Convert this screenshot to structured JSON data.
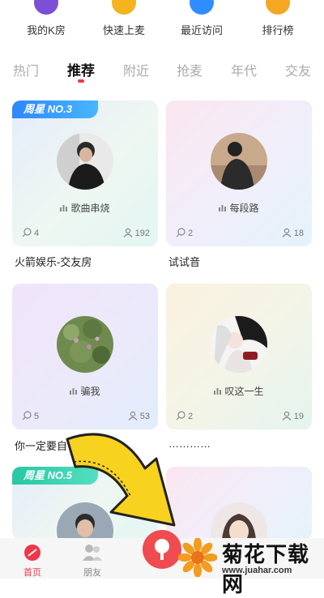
{
  "quick_entries": [
    {
      "label": "我的K房",
      "icon": "k-room-icon",
      "color": "#7b4fd6"
    },
    {
      "label": "快速上麦",
      "icon": "quick-mic-icon",
      "color": "#f5b31e"
    },
    {
      "label": "最近访问",
      "icon": "recent-visit-icon",
      "color": "#2f8dff"
    },
    {
      "label": "排行榜",
      "icon": "ranking-icon",
      "color": "#f5a623"
    }
  ],
  "tabs": [
    "热门",
    "推荐",
    "附近",
    "抢麦",
    "年代",
    "交友"
  ],
  "active_tab": "推荐",
  "rooms": [
    {
      "badge": "周星 NO.3",
      "song": "歌曲串烧",
      "comments": "4",
      "members": "192",
      "title": "火箭娱乐-交友房"
    },
    {
      "badge": "",
      "song": "每段路",
      "comments": "2",
      "members": "18",
      "title": "试试音"
    },
    {
      "badge": "",
      "song": "骗我",
      "comments": "5",
      "members": "53",
      "title": "你一定要自"
    },
    {
      "badge": "",
      "song": "叹这一生",
      "comments": "2",
      "members": "19",
      "title": "…………"
    },
    {
      "badge": "周星 NO.5"
    }
  ],
  "bottom_nav": [
    {
      "label": "首页",
      "icon": "home-icon"
    },
    {
      "label": "朋友",
      "icon": "friends-icon"
    }
  ],
  "watermark": {
    "text": "菊花下载网",
    "url": "www.juahar.com"
  },
  "colors": {
    "accent": "#f0364a",
    "badge_blue": "#2f86ff",
    "badge_green": "#27c7a2"
  }
}
